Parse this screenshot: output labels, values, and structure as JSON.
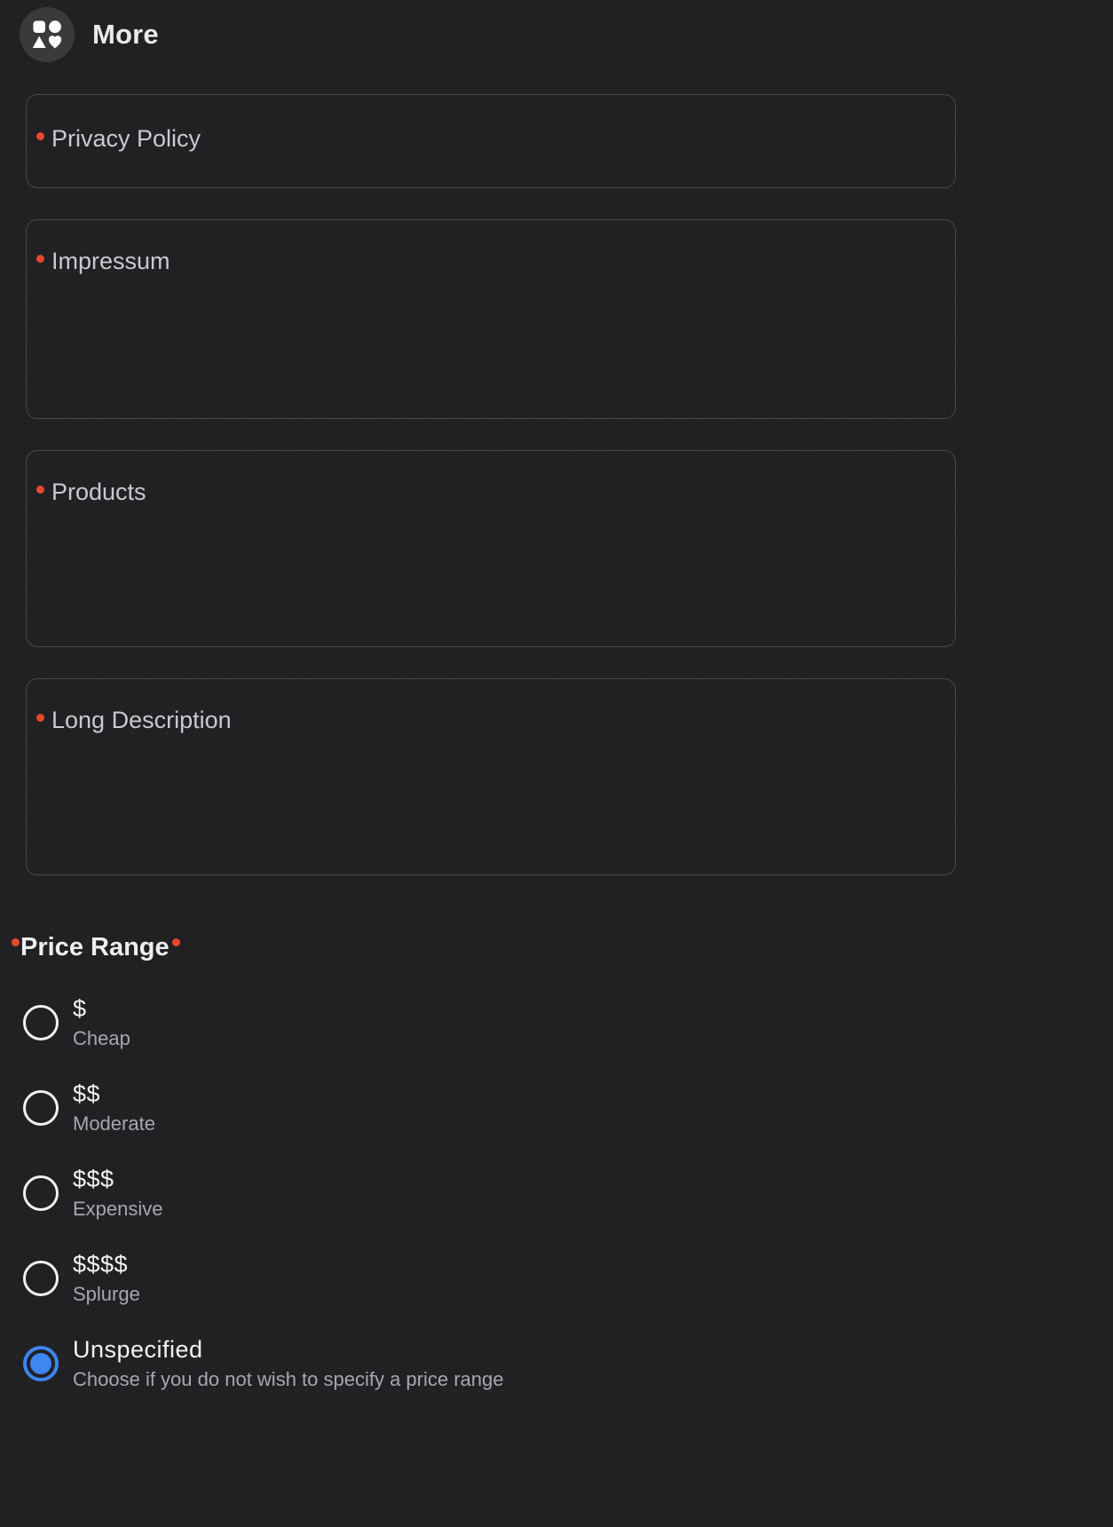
{
  "header": {
    "icon": "shapes-grid-icon",
    "title": "More"
  },
  "colors": {
    "background": "#212124",
    "card_border": "#47484b",
    "required_dot": "#e8482b",
    "selected_radio": "#3e86f0",
    "primary_text": "#f2f3f5",
    "secondary_text": "#a6a8ad"
  },
  "fields": [
    {
      "label": "Privacy Policy",
      "required": true,
      "size": "h-sm"
    },
    {
      "label": "Impressum",
      "required": true,
      "size": "h-md"
    },
    {
      "label": "Products",
      "required": true,
      "size": "h-lg"
    },
    {
      "label": "Long Description",
      "required": true,
      "size": "h-xl"
    }
  ],
  "price_range": {
    "heading": "Price Range",
    "required_leading": true,
    "required_trailing": true,
    "selected": "Unspecified",
    "options": [
      {
        "title": "$",
        "subtitle": "Cheap",
        "selected": false
      },
      {
        "title": "$$",
        "subtitle": "Moderate",
        "selected": false
      },
      {
        "title": "$$$",
        "subtitle": "Expensive",
        "selected": false
      },
      {
        "title": "$$$$",
        "subtitle": "Splurge",
        "selected": false
      },
      {
        "title": "Unspecified",
        "subtitle": "Choose if you do not wish to specify a price range",
        "selected": true
      }
    ]
  }
}
